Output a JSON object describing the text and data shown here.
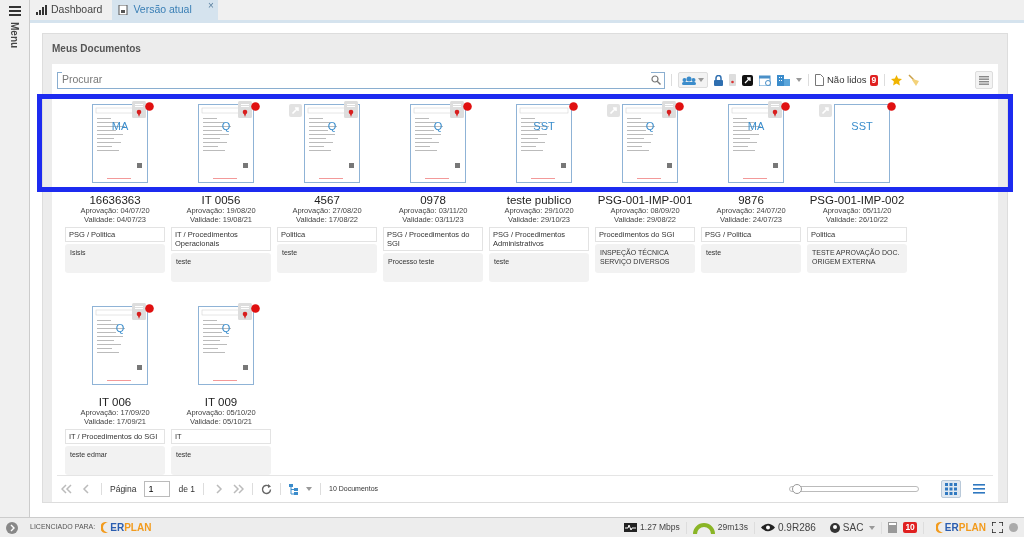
{
  "sidebar": {
    "label": "Menu"
  },
  "tabs": [
    {
      "label": "Dashboard",
      "selected": false
    },
    {
      "label": "Versão atual",
      "selected": true,
      "close": "×"
    }
  ],
  "panel": {
    "title": "Meus Documentos"
  },
  "search": {
    "placeholder": "Procurar"
  },
  "toolbar": {
    "unread_label": "Não lidos",
    "unread_count": "9"
  },
  "rows": [
    {
      "highlighted": true,
      "documents": [
        {
          "title": "16636363",
          "letter": "MA",
          "approval": "Aprovação: 04/07/20",
          "validity": "Validade: 04/07/23",
          "category": "PSG / Politica",
          "description": "Isisis",
          "kind": "page",
          "stamp": true,
          "alert": true,
          "link": false
        },
        {
          "title": "IT 0056",
          "letter": "Q",
          "approval": "Aprovação: 19/08/20",
          "validity": "Validade: 19/08/21",
          "category": "IT / Procedimentos Operacionais",
          "description": "teste",
          "kind": "page",
          "stamp": true,
          "alert": true,
          "link": false
        },
        {
          "title": "4567",
          "letter": "Q",
          "approval": "Aprovação: 27/08/20",
          "validity": "Validade: 17/08/22",
          "category": "Politica",
          "description": "teste",
          "kind": "page",
          "stamp": true,
          "alert": false,
          "link": true
        },
        {
          "title": "0978",
          "letter": "Q",
          "approval": "Aprovação: 03/11/20",
          "validity": "Validade: 03/11/23",
          "category": "PSG / Procedimentos do SGI",
          "description": "Processo teste",
          "kind": "page",
          "stamp": true,
          "alert": true,
          "link": false
        },
        {
          "title": "teste publico",
          "letter": "SST",
          "approval": "Aprovação: 29/10/20",
          "validity": "Validade: 29/10/23",
          "category": "PSG / Procedimentos Administrativos",
          "description": "teste",
          "kind": "page",
          "stamp": false,
          "alert": true,
          "link": false
        },
        {
          "title": "PSG-001-IMP-001",
          "letter": "Q",
          "approval": "Aprovação: 08/09/20",
          "validity": "Validade: 29/08/22",
          "category": "Procedimentos do SGI",
          "description": "INSPEÇÃO TÉCNICA SERVIÇO DIVERSOS",
          "kind": "page",
          "stamp": true,
          "alert": true,
          "link": true
        },
        {
          "title": "9876",
          "letter": "MA",
          "approval": "Aprovação: 24/07/20",
          "validity": "Validade: 24/07/23",
          "category": "PSG / Politica",
          "description": "teste",
          "kind": "page",
          "stamp": true,
          "alert": true,
          "link": false
        },
        {
          "title": "PSG-001-IMP-002",
          "letter": "SST",
          "approval": "Aprovação: 05/11/20",
          "validity": "Validade: 26/10/22",
          "category": "Politica",
          "description": "TESTE APROVAÇÃO DOC. ORIGEM EXTERNA",
          "kind": "blank",
          "stamp": false,
          "alert": true,
          "link": true
        }
      ]
    },
    {
      "highlighted": false,
      "documents": [
        {
          "title": "IT 006",
          "letter": "Q",
          "approval": "Aprovação: 17/09/20",
          "validity": "Validade: 17/09/21",
          "category": "IT / Procedimentos do SGI",
          "description": "teste edmar",
          "kind": "page",
          "stamp": true,
          "alert": true,
          "link": false
        },
        {
          "title": "IT 009",
          "letter": "Q",
          "approval": "Aprovação: 05/10/20",
          "validity": "Validade: 05/10/21",
          "category": "IT",
          "description": "teste",
          "kind": "page",
          "stamp": true,
          "alert": true,
          "link": false
        }
      ]
    }
  ],
  "pager": {
    "page_label": "Página",
    "page": "1",
    "of_label": "de 1",
    "count": "10 Documentos",
    "zoom": {
      "level": 0.02
    },
    "view": [
      {
        "kind": "grid",
        "selected": true
      },
      {
        "kind": "list",
        "selected": false
      }
    ]
  },
  "status_bar": {
    "license_label": "LICENCIADO PARA:",
    "logo": {
      "left": "ER",
      "right": "PLAN"
    },
    "speed": "1.27 Mbps",
    "time": "29m13s",
    "version": "0.9R286",
    "user": "SAC",
    "notifications": "10",
    "logo_right": {
      "left": "ER",
      "right": "PLAN"
    }
  }
}
